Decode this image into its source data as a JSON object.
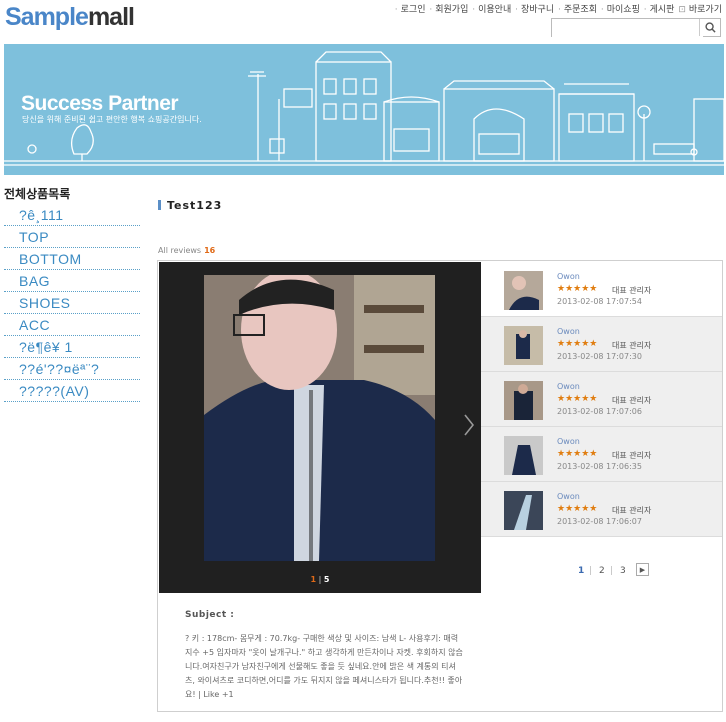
{
  "logo": {
    "part1": "Sample",
    "part2": "mall"
  },
  "top_nav": [
    "로그인",
    "회원가입",
    "이용안내",
    "장바구니",
    "주문조회",
    "마이쇼핑",
    "게시판",
    "바로가기"
  ],
  "search": {
    "value": ""
  },
  "banner": {
    "title": "Success Partner",
    "subtitle": "당신을 위해 준비된 쉽고 편안한 행복 쇼핑공간입니다."
  },
  "sidebar": {
    "heading": "전체상품목록",
    "items": [
      "?ê¸111",
      "TOP",
      "BOTTOM",
      "BAG",
      "SHOES",
      "ACC",
      "?ë¶ê¥ 1",
      "??é'??¤ëª¨?",
      "?????(AV)"
    ]
  },
  "page_title": "Test123",
  "reviews_count": {
    "label": "All reviews",
    "count": "16"
  },
  "viewer": {
    "current": "1",
    "total": "5"
  },
  "reviews": [
    {
      "name": "Owon",
      "stars": "★★★★★",
      "role": "대표 관리자",
      "date": "2013-02-08 17:07:54"
    },
    {
      "name": "Owon",
      "stars": "★★★★★",
      "role": "대표 관리자",
      "date": "2013-02-08 17:07:30"
    },
    {
      "name": "Owon",
      "stars": "★★★★★",
      "role": "대표 관리자",
      "date": "2013-02-08 17:07:06"
    },
    {
      "name": "Owon",
      "stars": "★★★★★",
      "role": "대표 관리자",
      "date": "2013-02-08 17:06:35"
    },
    {
      "name": "Owon",
      "stars": "★★★★★",
      "role": "대표 관리자",
      "date": "2013-02-08 17:06:07"
    }
  ],
  "list_pager": [
    "1",
    "2",
    "3"
  ],
  "review_content": {
    "subject_label": "Subject :",
    "body": "? 키 : 178cm- 몸무게 : 70.7kg- 구매한 색상 및 사이즈: 남색 L- 사용후기: 매력지수 +5 입자마자 \"옷이 날개구나.\" 하고 생각하게 만든차이나 자켓. 후회하지 않습니다.여자친구가 남자친구에게 선물해도 좋을 듯 싶네요.안에 밝은 색 계통의 티셔츠, 와이셔츠로 코디하면,어디를 가도 뒤지지 않을 페셔니스타가 됩니다.추천!! 좋아요! | Like +1"
  }
}
